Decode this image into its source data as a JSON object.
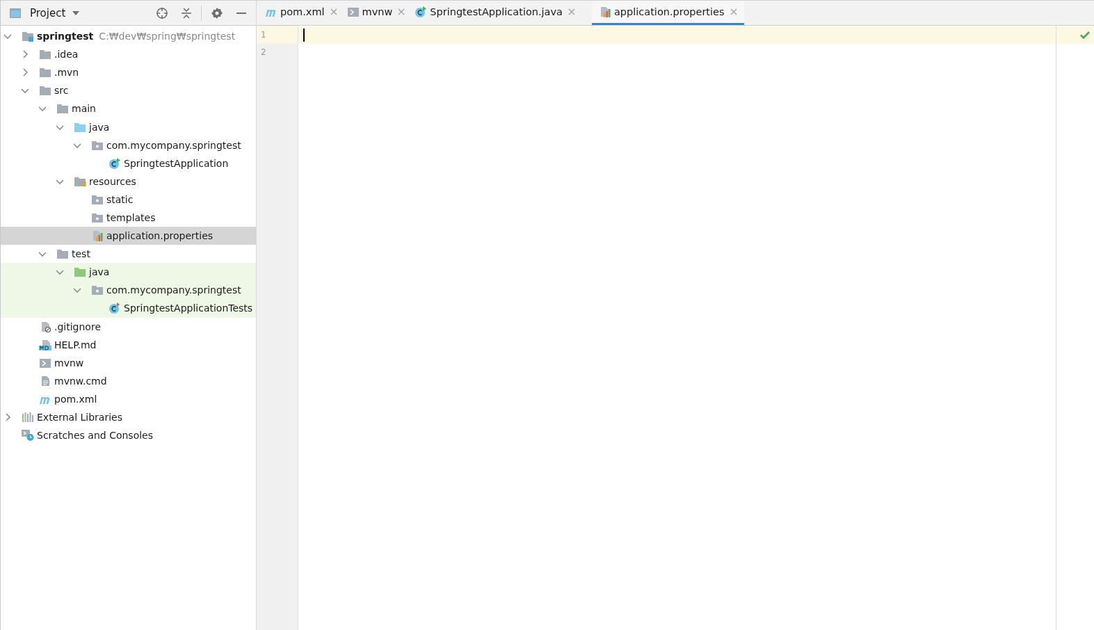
{
  "project_panel": {
    "title": "Project"
  },
  "tree": [
    {
      "label": "springtest",
      "path": "C:₩dev₩spring₩springtest",
      "kind": "project",
      "expanded": true,
      "selected": false,
      "test_scope": false,
      "children": [
        {
          "label": ".idea",
          "kind": "folder",
          "expanded": false,
          "selected": false,
          "test_scope": false
        },
        {
          "label": ".mvn",
          "kind": "folder",
          "expanded": false,
          "selected": false,
          "test_scope": false
        },
        {
          "label": "src",
          "kind": "folder",
          "expanded": true,
          "selected": false,
          "test_scope": false,
          "children": [
            {
              "label": "main",
              "kind": "folder",
              "expanded": true,
              "selected": false,
              "test_scope": false,
              "children": [
                {
                  "label": "java",
                  "kind": "source-folder",
                  "expanded": true,
                  "selected": false,
                  "test_scope": false,
                  "children": [
                    {
                      "label": "com.mycompany.springtest",
                      "kind": "package",
                      "expanded": true,
                      "selected": false,
                      "test_scope": false,
                      "children": [
                        {
                          "label": "SpringtestApplication",
                          "kind": "class",
                          "selected": false,
                          "test_scope": false
                        }
                      ]
                    }
                  ]
                },
                {
                  "label": "resources",
                  "kind": "resources-folder",
                  "expanded": true,
                  "selected": false,
                  "test_scope": false,
                  "children": [
                    {
                      "label": "static",
                      "kind": "package",
                      "selected": false,
                      "test_scope": false
                    },
                    {
                      "label": "templates",
                      "kind": "package",
                      "selected": false,
                      "test_scope": false
                    },
                    {
                      "label": "application.properties",
                      "kind": "properties",
                      "selected": true,
                      "test_scope": false
                    }
                  ]
                }
              ]
            },
            {
              "label": "test",
              "kind": "folder",
              "expanded": true,
              "selected": false,
              "test_scope": false,
              "children": [
                {
                  "label": "java",
                  "kind": "test-folder",
                  "expanded": true,
                  "selected": false,
                  "test_scope": true,
                  "children": [
                    {
                      "label": "com.mycompany.springtest",
                      "kind": "package",
                      "expanded": true,
                      "selected": false,
                      "test_scope": true,
                      "children": [
                        {
                          "label": "SpringtestApplicationTests",
                          "kind": "test-class",
                          "selected": false,
                          "test_scope": true
                        }
                      ]
                    }
                  ]
                }
              ]
            }
          ]
        },
        {
          "label": ".gitignore",
          "kind": "gitignore",
          "selected": false,
          "test_scope": false
        },
        {
          "label": "HELP.md",
          "kind": "markdown",
          "selected": false,
          "test_scope": false
        },
        {
          "label": "mvnw",
          "kind": "shell",
          "selected": false,
          "test_scope": false
        },
        {
          "label": "mvnw.cmd",
          "kind": "text",
          "selected": false,
          "test_scope": false
        },
        {
          "label": "pom.xml",
          "kind": "maven",
          "selected": false,
          "test_scope": false
        }
      ]
    },
    {
      "label": "External Libraries",
      "kind": "libraries",
      "expanded": false,
      "selected": false,
      "test_scope": false
    },
    {
      "label": "Scratches and Consoles",
      "kind": "scratches",
      "selected": false,
      "test_scope": false
    }
  ],
  "tabs": [
    {
      "label": "pom.xml",
      "kind": "maven",
      "selected": false
    },
    {
      "label": "mvnw",
      "kind": "shell",
      "selected": false
    },
    {
      "label": "SpringtestApplication.java",
      "kind": "class",
      "selected": false
    },
    {
      "label": "application.properties",
      "kind": "properties",
      "selected": true
    }
  ],
  "editor": {
    "line_numbers": [
      "1",
      "2"
    ]
  }
}
